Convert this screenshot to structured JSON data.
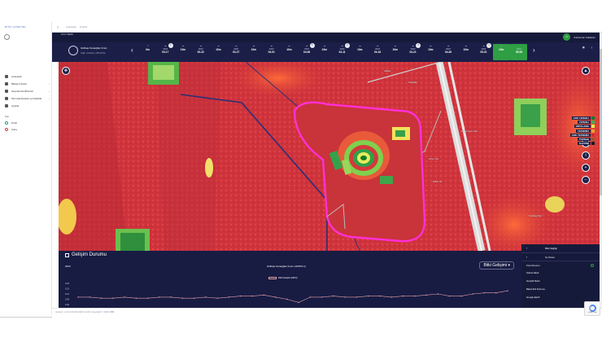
{
  "sidebar": {
    "brand": "BİTKİ GÖZETİMİ",
    "items": [
      {
        "label": "Anasayfa"
      },
      {
        "label": "Bitkisel Üretim",
        "has_children": true
      },
      {
        "label": "Hayvancılık Birimleri",
        "has_children": true
      },
      {
        "label": "Tarımsal Destek ve İstatistik",
        "has_children": true
      },
      {
        "label": "Ayarlar"
      }
    ],
    "section_label": "Kişi",
    "links": [
      {
        "label": "Profil",
        "color": "#2a9d8f"
      },
      {
        "label": "Çıkış",
        "color": "#d94040"
      }
    ]
  },
  "topbar": {
    "menu_icon": "hamburger-icon",
    "breadcrumbs": [
      "Anasayfa",
      "Ürünler"
    ]
  },
  "header": {
    "title": "Ürün Takibi",
    "user_initials": "KK",
    "user_name": "Kahraman Kaldaran"
  },
  "field": {
    "name": "Gölbaşı Karaoğlan İmarı",
    "subtitle": "Ciğer | Ankara | 135.29 Ha"
  },
  "timeline": {
    "items": [
      {
        "cloud": "0",
        "year": "",
        "date": "0m",
        "active": false
      },
      {
        "cloud": "☁",
        "year": "2023",
        "date": "03-17",
        "badge": "1",
        "active": false
      },
      {
        "cloud": "☁",
        "year": "",
        "date": "10m",
        "active": false
      },
      {
        "cloud": "☁",
        "year": "2023",
        "date": "03-22",
        "active": false
      },
      {
        "cloud": "☁",
        "year": "",
        "date": "10m",
        "active": false
      },
      {
        "cloud": "☁",
        "year": "2023",
        "date": "03-27",
        "active": false
      },
      {
        "cloud": "☁",
        "year": "",
        "date": "10m",
        "active": false
      },
      {
        "cloud": "☁",
        "year": "2023",
        "date": "04-01",
        "active": false
      },
      {
        "cloud": "☁",
        "year": "",
        "date": "10m",
        "active": false
      },
      {
        "cloud": "☁",
        "year": "2023",
        "date": "04-06",
        "badge": "5",
        "active": false
      },
      {
        "cloud": "☁",
        "year": "",
        "date": "10m",
        "active": false
      },
      {
        "cloud": "☁",
        "year": "2023",
        "date": "04-11",
        "badge": "2",
        "active": false
      },
      {
        "cloud": "☁",
        "year": "",
        "date": "10m",
        "active": false
      },
      {
        "cloud": "☁",
        "year": "2023",
        "date": "04-16",
        "active": false
      },
      {
        "cloud": "☁",
        "year": "",
        "date": "10m",
        "active": false
      },
      {
        "cloud": "☁",
        "year": "2023",
        "date": "04-21",
        "badge": "3",
        "active": false
      },
      {
        "cloud": "☁",
        "year": "",
        "date": "10m",
        "active": false
      },
      {
        "cloud": "☁",
        "year": "2023",
        "date": "04-26",
        "active": false
      },
      {
        "cloud": "☁",
        "year": "",
        "date": "10m",
        "active": false
      },
      {
        "cloud": "☁",
        "year": "2023",
        "date": "05-01",
        "badge": "1",
        "active": false
      },
      {
        "cloud": "☁",
        "year": "",
        "date": "10m",
        "active": true
      },
      {
        "cloud": "",
        "year": "2023",
        "date": "05-06",
        "active": true
      }
    ],
    "prev_icon": "‹",
    "next_icon": "›",
    "right_tools": [
      "Tarih",
      "İndir"
    ]
  },
  "map": {
    "legend": [
      {
        "label": "ÇOK YETERLİ",
        "color": "#0f7a2a"
      },
      {
        "label": "YETERLİ",
        "color": "#44b04a"
      },
      {
        "label": "ORTALAMA",
        "color": "#e8e84a"
      },
      {
        "label": "YETERSİZ",
        "color": "#f59a2e"
      },
      {
        "label": "ÇOK YETERSİZ",
        "color": "#d62c2c"
      },
      {
        "label": "TOPRAK",
        "color": "#a0522d"
      },
      {
        "label": "İLGİ DIŞI",
        "color": "#1c1c1c"
      }
    ],
    "place_labels": [
      "Gölbaşı",
      "Karaoğlan",
      "Ankara Çevre Yolu",
      "Kuzey Yolu",
      "Ahiboz Cd.",
      "Tulumtaş Köyü"
    ],
    "tools": {
      "compass_icon": "compass-icon",
      "north_icon": "north-arrow-icon",
      "layers_icon": "layers-icon",
      "info_icon": "info-icon",
      "zoom_in_icon": "zoom-in-icon",
      "zoom_out_icon": "zoom-out-icon"
    }
  },
  "chart_panel": {
    "title": "Gelişim Durumu",
    "year": "2023",
    "field_title": "Gölbaşı Karaoğlan İmarı (115976-1)",
    "select_label": "Bitki Gelişimi",
    "collapse_icon": "^"
  },
  "chart_data": {
    "type": "line",
    "title": "",
    "series": [
      {
        "name": "2023 Gelişimi (NDVI)",
        "values": [
          0.07,
          0.07,
          0.06,
          0.06,
          0.07,
          0.06,
          0.06,
          0.07,
          0.07,
          0.06,
          0.06,
          0.07,
          0.06,
          0.07,
          0.08,
          0.08,
          0.09,
          0.07,
          0.05,
          0.02,
          0.07,
          0.07,
          0.08,
          0.07,
          0.07,
          0.08,
          0.08,
          0.07,
          0.08,
          0.08,
          0.09,
          0.1,
          0.08,
          0.08,
          0.1,
          0.11,
          0.11,
          0.13
        ]
      }
    ],
    "y_ticks": [
      "0.20",
      "0.15",
      "0.10",
      "0.05",
      "0.00"
    ],
    "ylim": [
      0,
      0.2
    ]
  },
  "layers_panel": {
    "items": [
      {
        "label": "Bitki Sağlığı",
        "chevron": "‹"
      },
      {
        "label": "Su Stresi",
        "chevron": "‹"
      },
      {
        "label": "Kum Durumu",
        "checked": true
      },
      {
        "label": "Sulma Rank"
      },
      {
        "label": "Gençlik Rank"
      },
      {
        "label": "Bakımlılık Durumu"
      },
      {
        "label": "Google Earth"
      }
    ]
  },
  "footer": {
    "text": "Version: v1.0.0 (03-05-2023 14:22) Copyright © 2023 NBB"
  },
  "recaptcha": {
    "text": "reCAPTCHA"
  }
}
